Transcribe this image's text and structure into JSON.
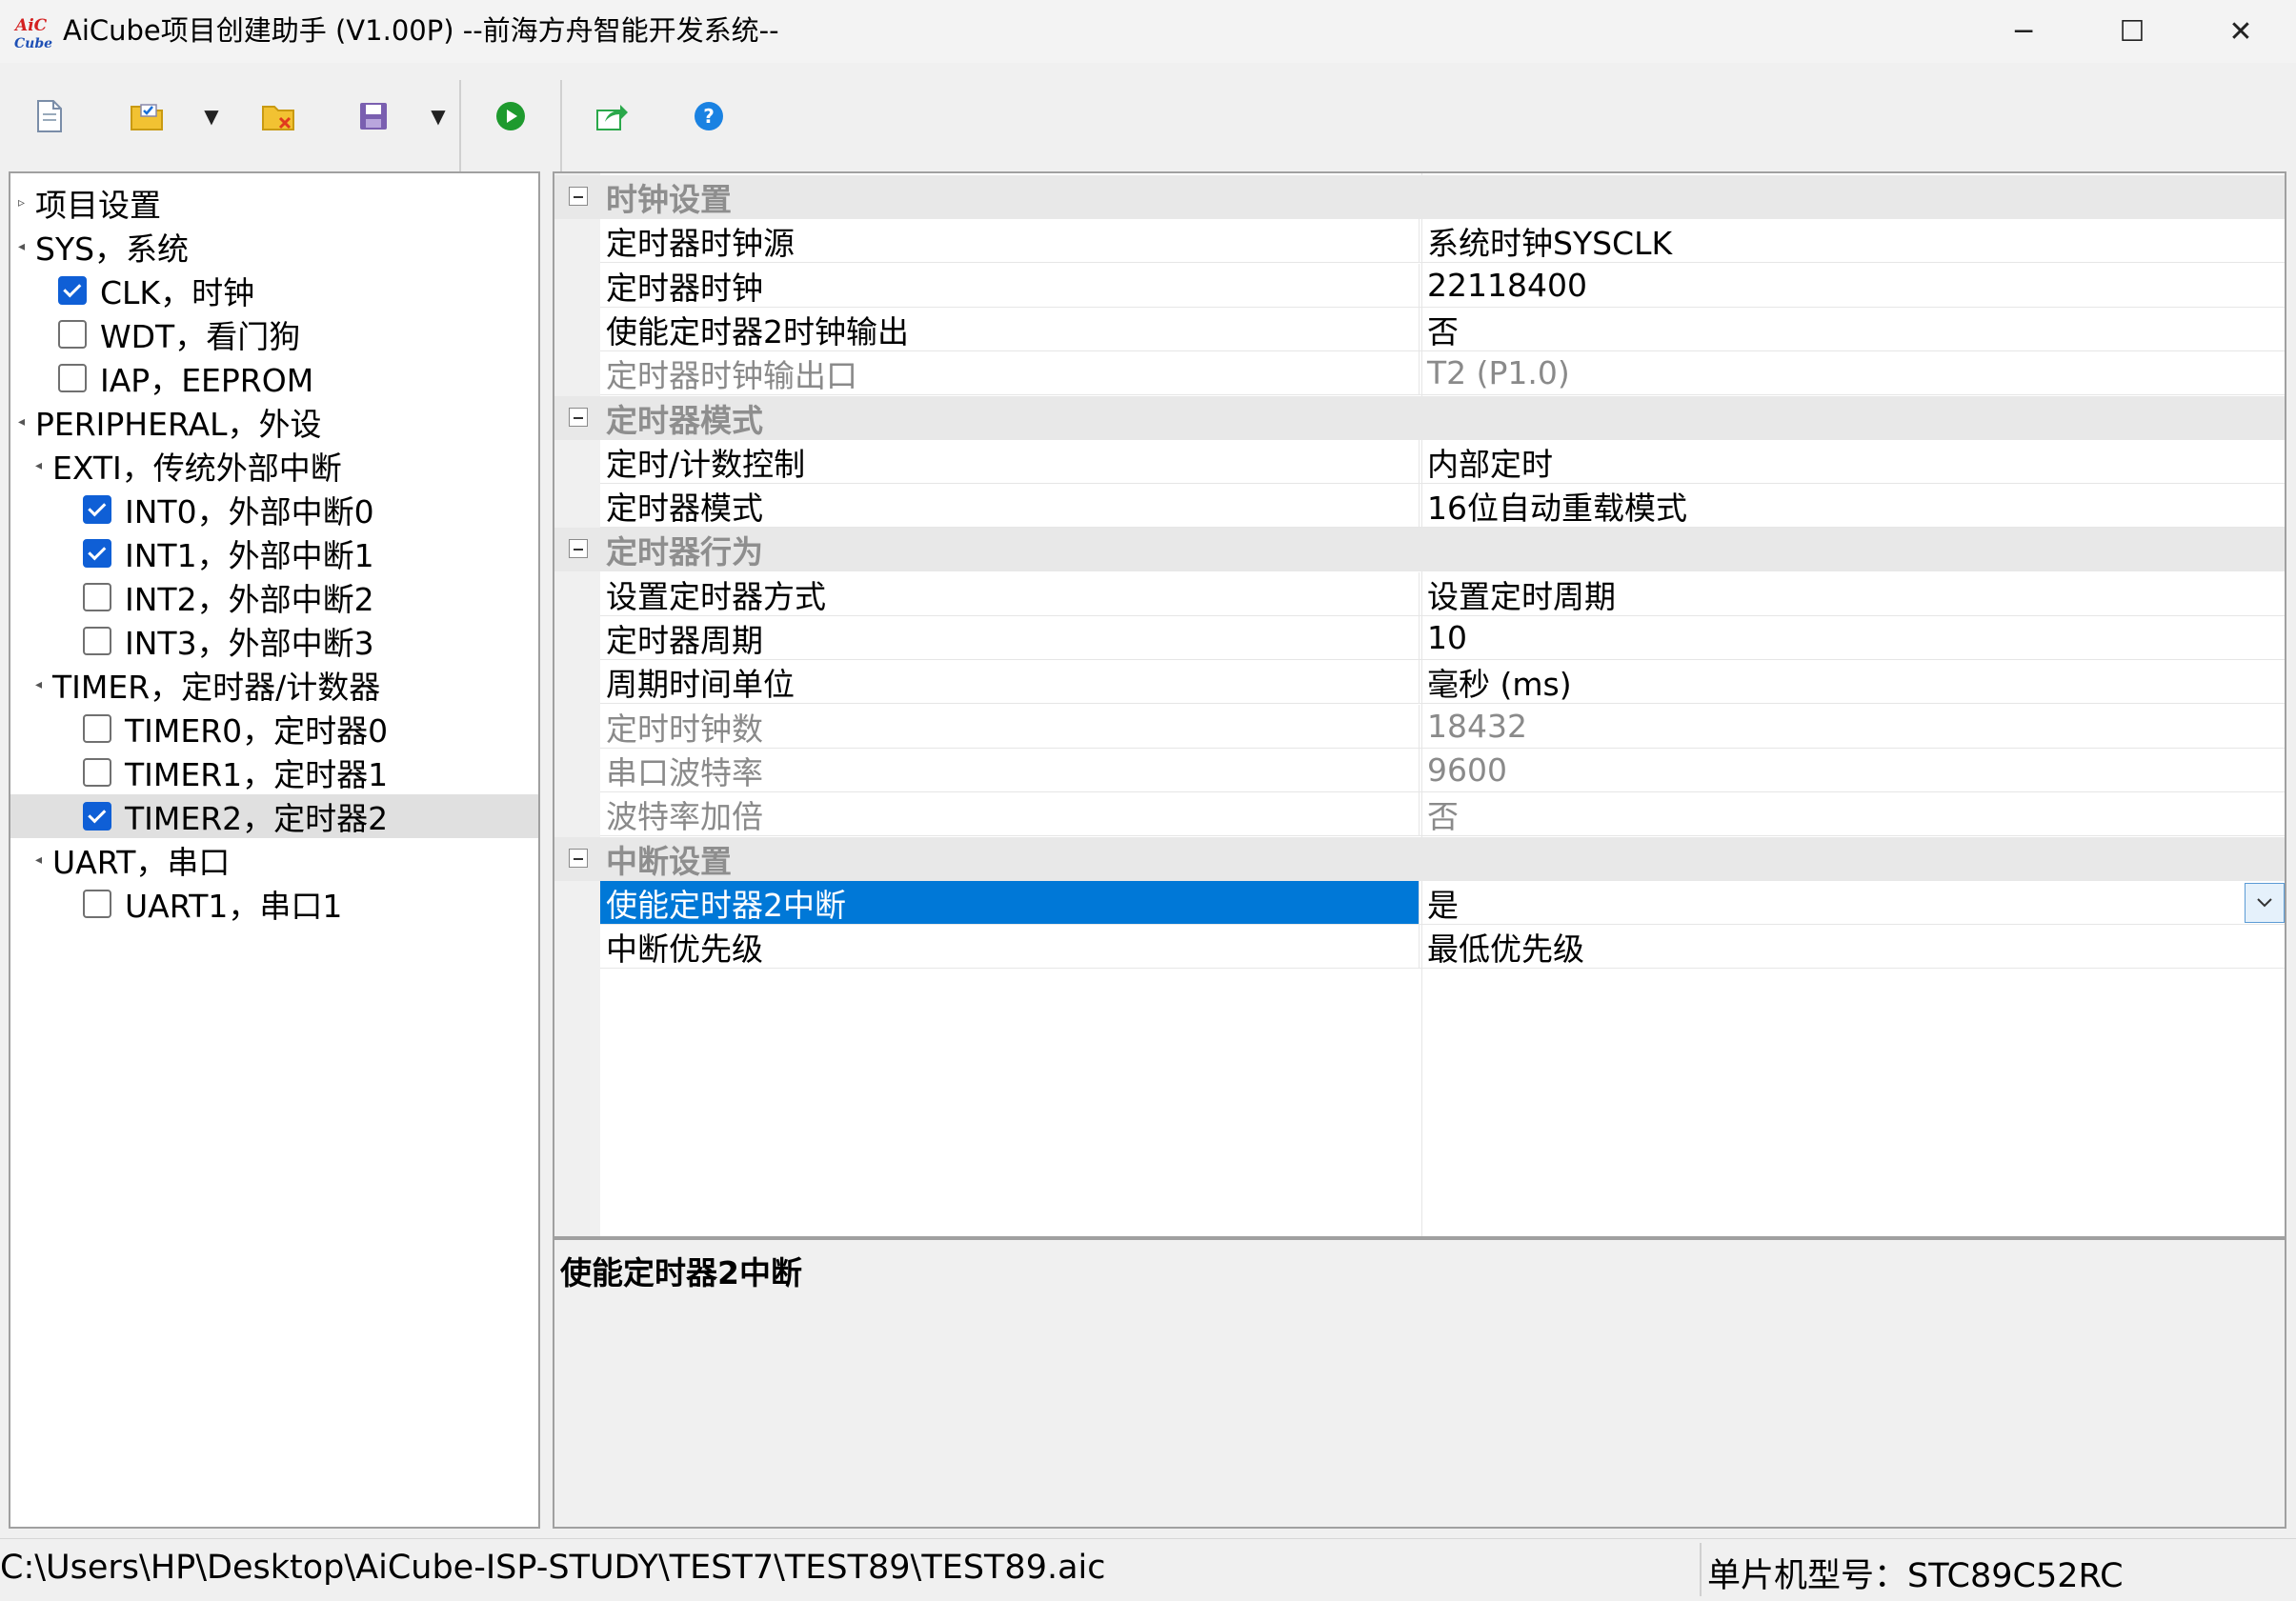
{
  "window": {
    "logo_text": "AiC Cube",
    "title": "AiCube项目创建助手 (V1.00P) --前海方舟智能开发系统--",
    "controls": {
      "minimize": "─",
      "maximize": "☐",
      "close": "✕"
    }
  },
  "toolbar": {
    "icons": [
      "new-file-icon",
      "open-folder-icon",
      "close-file-icon",
      "save-icon",
      "run-icon",
      "export-icon",
      "help-icon"
    ],
    "colors": {
      "run": "#1e9a2e",
      "help": "#1a82e2",
      "export": "#2aa84a",
      "folder": "#f2c232",
      "save": "#7a5fb0"
    }
  },
  "tree": {
    "items": [
      {
        "label": "项目设置",
        "level": 0,
        "checkbox": false,
        "arrow": "▹"
      },
      {
        "label": "SYS，系统",
        "level": 0,
        "checkbox": false,
        "arrow": "◂"
      },
      {
        "label": "CLK，时钟",
        "level": 1,
        "checkbox": true,
        "checked": true
      },
      {
        "label": "WDT，看门狗",
        "level": 1,
        "checkbox": true,
        "checked": false
      },
      {
        "label": "IAP，EEPROM",
        "level": 1,
        "checkbox": true,
        "checked": false
      },
      {
        "label": "PERIPHERAL，外设",
        "level": 0,
        "checkbox": false,
        "arrow": "◂"
      },
      {
        "label": "EXTI，传统外部中断",
        "level": 1,
        "checkbox": false,
        "arrow": "◂"
      },
      {
        "label": "INT0，外部中断0",
        "level": 2,
        "checkbox": true,
        "checked": true
      },
      {
        "label": "INT1，外部中断1",
        "level": 2,
        "checkbox": true,
        "checked": true
      },
      {
        "label": "INT2，外部中断2",
        "level": 2,
        "checkbox": true,
        "checked": false
      },
      {
        "label": "INT3，外部中断3",
        "level": 2,
        "checkbox": true,
        "checked": false
      },
      {
        "label": "TIMER，定时器/计数器",
        "level": 1,
        "checkbox": false,
        "arrow": "◂"
      },
      {
        "label": "TIMER0，定时器0",
        "level": 2,
        "checkbox": true,
        "checked": false
      },
      {
        "label": "TIMER1，定时器1",
        "level": 2,
        "checkbox": true,
        "checked": false
      },
      {
        "label": "TIMER2，定时器2",
        "level": 2,
        "checkbox": true,
        "checked": true,
        "selected": true
      },
      {
        "label": "UART，串口",
        "level": 1,
        "checkbox": false,
        "arrow": "◂"
      },
      {
        "label": "UART1，串口1",
        "level": 2,
        "checkbox": true,
        "checked": false
      }
    ]
  },
  "grid": {
    "rows": [
      {
        "type": "category",
        "label": "时钟设置"
      },
      {
        "type": "prop",
        "name": "定时器时钟源",
        "value": "系统时钟SYSCLK"
      },
      {
        "type": "prop",
        "name": "定时器时钟",
        "value": "22118400"
      },
      {
        "type": "prop",
        "name": "使能定时器2时钟输出",
        "value": "否"
      },
      {
        "type": "prop",
        "name": "定时器时钟输出口",
        "value": "T2 (P1.0)",
        "disabled": true
      },
      {
        "type": "category",
        "label": "定时器模式"
      },
      {
        "type": "prop",
        "name": "定时/计数控制",
        "value": "内部定时"
      },
      {
        "type": "prop",
        "name": "定时器模式",
        "value": "16位自动重载模式"
      },
      {
        "type": "category",
        "label": "定时器行为"
      },
      {
        "type": "prop",
        "name": "设置定时器方式",
        "value": "设置定时周期"
      },
      {
        "type": "prop",
        "name": "定时器周期",
        "value": "10"
      },
      {
        "type": "prop",
        "name": "周期时间单位",
        "value": "毫秒 (ms)"
      },
      {
        "type": "prop",
        "name": "定时时钟数",
        "value": "18432",
        "disabled": true
      },
      {
        "type": "prop",
        "name": "串口波特率",
        "value": "9600",
        "disabled": true
      },
      {
        "type": "prop",
        "name": "波特率加倍",
        "value": "否",
        "disabled": true
      },
      {
        "type": "category",
        "label": "中断设置"
      },
      {
        "type": "prop",
        "name": "使能定时器2中断",
        "value": "是",
        "selected": true,
        "dropdown": true
      },
      {
        "type": "prop",
        "name": "中断优先级",
        "value": "最低优先级"
      }
    ],
    "selection_color": "#0078d7"
  },
  "description": {
    "title": "使能定时器2中断"
  },
  "status": {
    "path": "C:\\Users\\HP\\Desktop\\AiCube-ISP-STUDY\\TEST7\\TEST89\\TEST89.aic",
    "chip": "单片机型号：STC89C52RC"
  }
}
